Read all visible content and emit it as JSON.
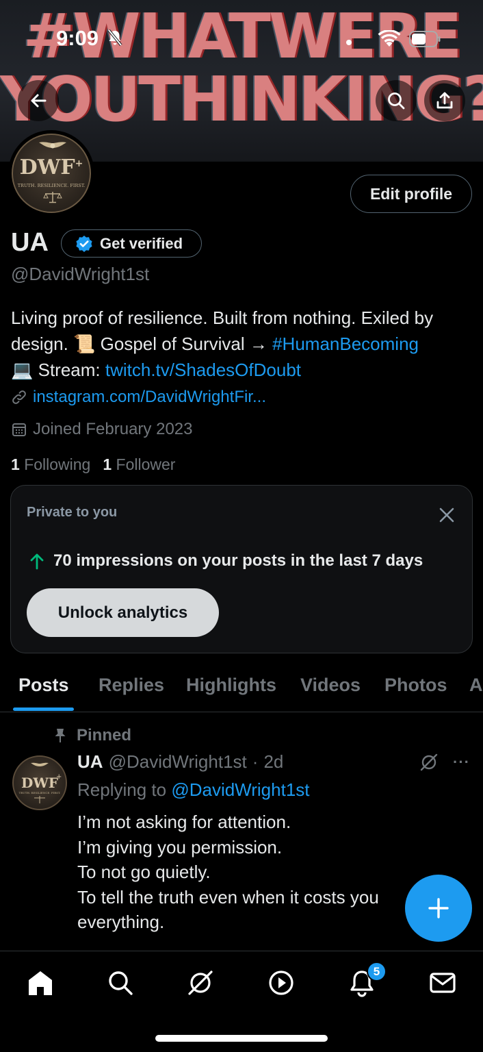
{
  "status_bar": {
    "time": "9:09"
  },
  "banner": {
    "line1": "#WHATWERE",
    "line2": "YOUTHINKING?"
  },
  "avatar": {
    "letters": "DWF",
    "superscript": "+",
    "tagline": "TRUTH. RESILIENCE. FIRST."
  },
  "profile": {
    "edit_label": "Edit profile",
    "name": "UA",
    "verify_label": "Get verified",
    "handle": "@DavidWright1st",
    "bio": {
      "line1": "Living proof of resilience. Built from nothing. Exiled by",
      "line2_text": "design. 📜 Gospel of Survival → ",
      "line2_hashtag": "#HumanBecoming",
      "line3_text": "💻 Stream: ",
      "line3_link": "twitch.tv/ShadesOfDoubt"
    },
    "website": "instagram.com/DavidWrightFir...",
    "joined": "Joined February 2023",
    "following_count": "1",
    "following_label": "Following",
    "followers_count": "1",
    "followers_label": "Follower"
  },
  "private_card": {
    "label": "Private to you",
    "impressions_text": "70 impressions on your posts in the last 7 days",
    "unlock_label": "Unlock analytics"
  },
  "tabs": [
    "Posts",
    "Replies",
    "Highlights",
    "Videos",
    "Photos",
    "A"
  ],
  "active_tab": "Posts",
  "post": {
    "pinned_label": "Pinned",
    "author_name": "UA",
    "author_handle": "@DavidWright1st",
    "separator": "·",
    "age": "2d",
    "replying_prefix": "Replying to ",
    "replying_handle": "@DavidWright1st",
    "lines": [
      "I’m not asking for attention.",
      "I’m giving you permission.",
      "To not go quietly.",
      "To tell the truth even when it costs you",
      "everything."
    ],
    "more_glyph": "···"
  },
  "bottom_nav": {
    "items": [
      "home-icon",
      "search-icon",
      "grok-icon",
      "video-icon",
      "notifications-icon",
      "messages-icon"
    ],
    "notifications_badge": "5"
  },
  "colors": {
    "accent": "#1d9bf0",
    "background": "#000000",
    "muted_text": "#71767b",
    "growth_green": "#00ba7c"
  }
}
